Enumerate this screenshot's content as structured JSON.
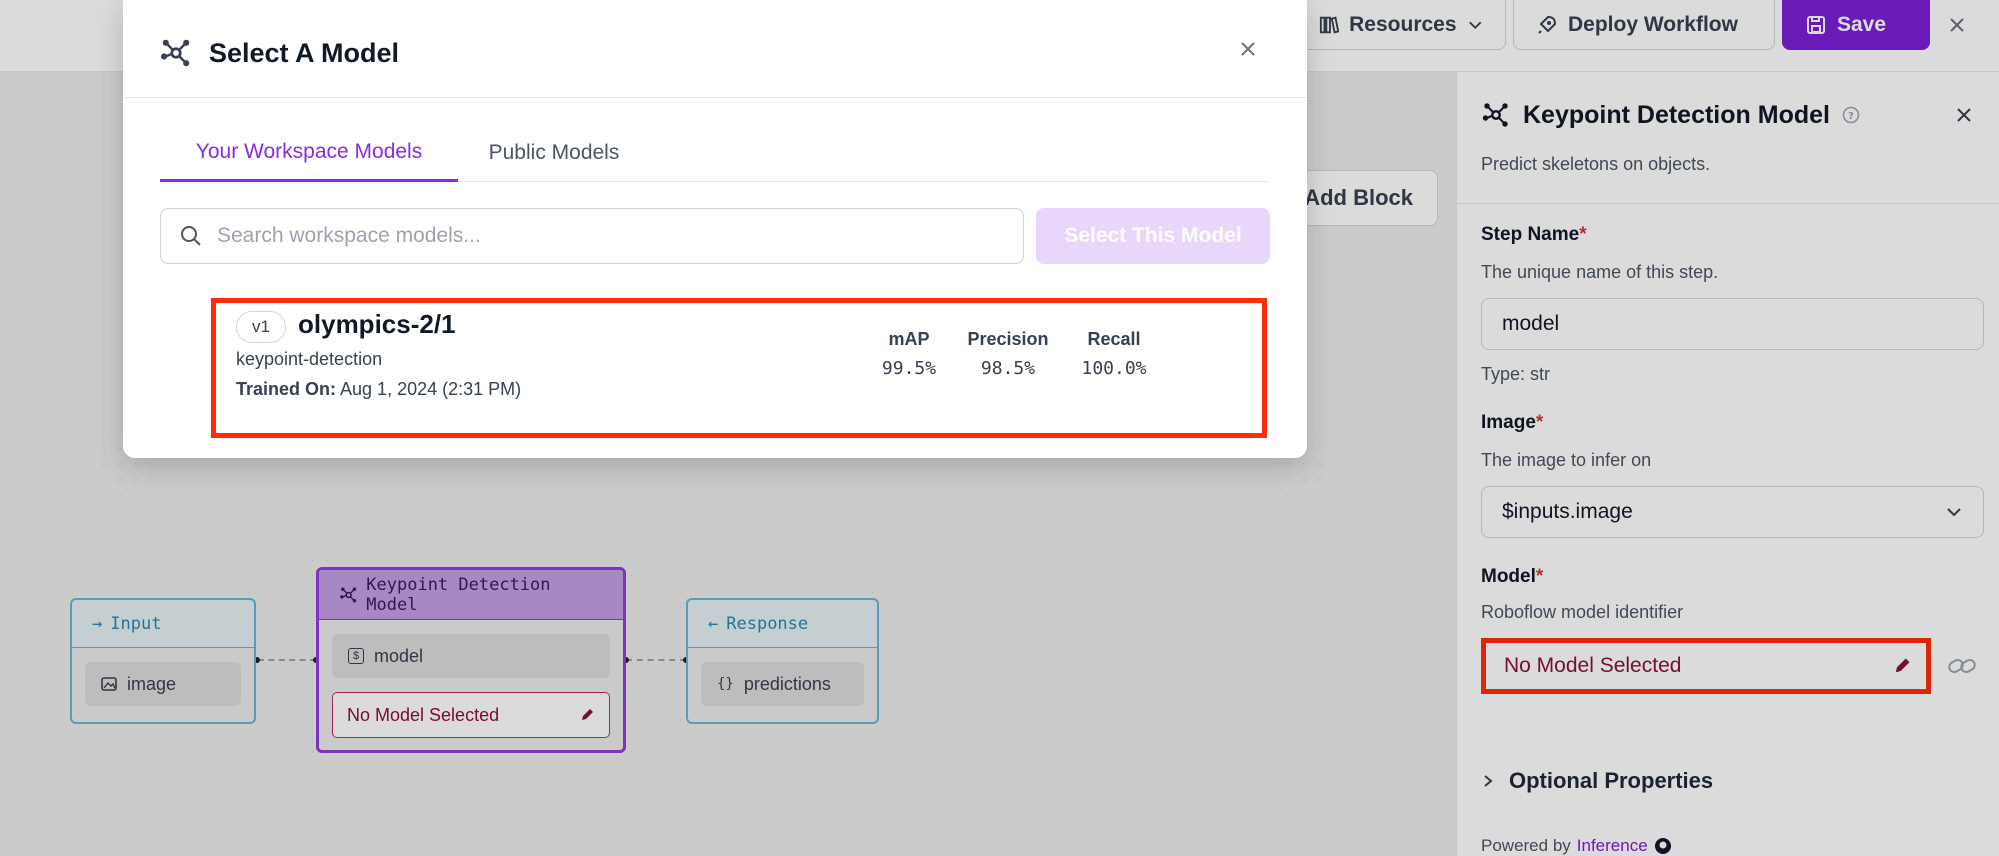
{
  "topbar": {
    "resources_label": "Resources",
    "deploy_label": "Deploy Workflow",
    "save_label": "Save"
  },
  "canvas": {
    "add_block_label": "Add Block",
    "nodes": {
      "input": {
        "title": "Input",
        "field": "image"
      },
      "keypoint": {
        "title": "Keypoint Detection Model",
        "field": "model",
        "model_status": "No Model Selected"
      },
      "response": {
        "title": "Response",
        "field": "predictions"
      }
    }
  },
  "panel": {
    "title": "Keypoint Detection Model",
    "subtitle": "Predict skeletons on objects.",
    "step_name": {
      "label": "Step Name",
      "required": "*",
      "description": "The unique name of this step.",
      "value": "model",
      "type_hint": "Type: str"
    },
    "image": {
      "label": "Image",
      "required": "*",
      "description": "The image to infer on",
      "value": "$inputs.image"
    },
    "model": {
      "label": "Model",
      "required": "*",
      "description": "Roboflow model identifier",
      "value": "No Model Selected"
    },
    "optional_label": "Optional Properties",
    "powered_by": "Powered by",
    "powered_link": "Inference"
  },
  "modal": {
    "title": "Select A Model",
    "tabs": [
      "Your Workspace Models",
      "Public Models"
    ],
    "active_tab": "Your Workspace Models",
    "search_placeholder": "Search workspace models...",
    "select_button": "Select This Model",
    "model": {
      "version": "v1",
      "name": "olympics-2/1",
      "type": "keypoint-detection",
      "trained_label": "Trained On:",
      "trained_value": "Aug 1, 2024 (2:31 PM)",
      "metrics": [
        {
          "label": "mAP",
          "value": "99.5%"
        },
        {
          "label": "Precision",
          "value": "98.5%"
        },
        {
          "label": "Recall",
          "value": "100.0%"
        }
      ]
    }
  },
  "colors": {
    "accent": "#7c1fd6",
    "highlight": "#ff2d0a",
    "error_text": "#8a1238",
    "node_blue": "#6ab5d4"
  }
}
